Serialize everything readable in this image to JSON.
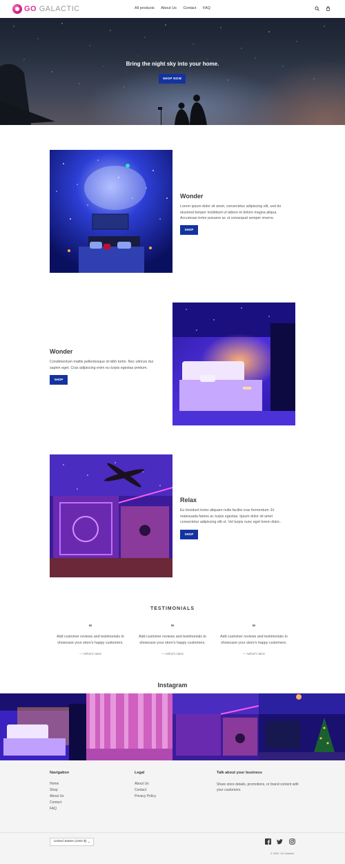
{
  "header": {
    "logo_go": "GO",
    "logo_rest": "GALACTIC",
    "nav": [
      "All products",
      "About Us",
      "Contact",
      "FAQ"
    ]
  },
  "hero": {
    "title": "Bring the night sky into your home.",
    "button": "SHOP NOW"
  },
  "features": [
    {
      "title": "Wonder",
      "text": "Lorem ipsum dolor sit amet, consectetur adipiscing elit, sed do eiusmod tempor incididunt ut labore et dolore magna aliqua. Accumsan tortor posuere ac ut consequat semper viverra.",
      "button": "SHOP"
    },
    {
      "title": "Wonder",
      "text": "Condimentum mattis pellentesque id nibh tortor. Nec ultrices dui sapien eget. Cras adipiscing enim eu turpis egestas pretium.",
      "button": "SHOP"
    },
    {
      "title": "Relax",
      "text": "Eu tincidunt tortor aliquam nulla facilisi cras fermentum. Et malesuada fames ac turpis egestas. Ipsum dolor sit amet consectetur adipiscing elit ut. Vel turpis nunc eget lorem dolor..",
      "button": "SHOP"
    }
  ],
  "testimonials": {
    "heading": "TESTIMONIALS",
    "items": [
      {
        "quote": "“",
        "text": "Add customer reviews and testimonials to showcase your store's happy customers.",
        "author": "— Author's name"
      },
      {
        "quote": "“",
        "text": "Add customer reviews and testimonials to showcase your store's happy customers.",
        "author": "— Author's name"
      },
      {
        "quote": "“",
        "text": "Add customer reviews and testimonials to showcase your store's happy customers.",
        "author": "— Author's name"
      }
    ]
  },
  "instagram": {
    "heading": "Instagram"
  },
  "footer": {
    "navigation": {
      "heading": "Navigation",
      "links": [
        "Home",
        "Shop",
        "About Us",
        "Contact",
        "FAQ"
      ]
    },
    "legal": {
      "heading": "Legal",
      "links": [
        "About Us",
        "Contact",
        "Privacy Policy"
      ]
    },
    "about": {
      "heading": "Talk about your business",
      "text": "Share store details, promotions, or brand content with your customers."
    },
    "currency": "United States (USD $)",
    "copyright": "© 2022, Go Galactic"
  },
  "colors": {
    "accent": "#14339f",
    "brand_pink": "#e0308f",
    "footer_bg": "#f4f4f4"
  },
  "icons": [
    "search-icon",
    "cart-icon",
    "facebook-icon",
    "twitter-icon",
    "instagram-icon",
    "chevron-down-icon"
  ]
}
